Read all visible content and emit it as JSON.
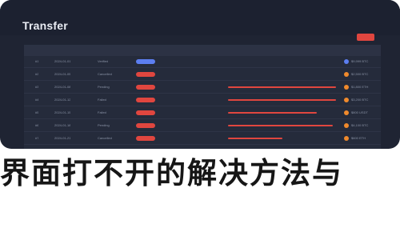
{
  "window": {
    "title": "Transfer"
  },
  "grid": {
    "rows": [
      {
        "id": "#1",
        "date": "2024-01-01",
        "name": "Verified",
        "status_color": "#5c7ef0",
        "line_fraction": 0.0,
        "dot_color": "#5c7ef0",
        "amount": "$9,999 BTC"
      },
      {
        "id": "#2",
        "date": "2024-01-05",
        "name": "Cancelled",
        "status_color": "#e0463f",
        "line_fraction": 0.0,
        "dot_color": "#f08a2c",
        "amount": "$2,500 BTC"
      },
      {
        "id": "#3",
        "date": "2024-01-08",
        "name": "Pending",
        "status_color": "#e0463f",
        "line_fraction": 1.0,
        "dot_color": "#f08a2c",
        "amount": "$1,800 ETH"
      },
      {
        "id": "#4",
        "date": "2024-01-12",
        "name": "Failed",
        "status_color": "#e0463f",
        "line_fraction": 1.0,
        "dot_color": "#f08a2c",
        "amount": "$3,200 BTC"
      },
      {
        "id": "#5",
        "date": "2024-01-15",
        "name": "Failed",
        "status_color": "#e0463f",
        "line_fraction": 0.82,
        "dot_color": "#f08a2c",
        "amount": "$800 USDT"
      },
      {
        "id": "#6",
        "date": "2024-01-18",
        "name": "Pending",
        "status_color": "#e0463f",
        "line_fraction": 0.97,
        "dot_color": "#f08a2c",
        "amount": "$4,100 BTC"
      },
      {
        "id": "#7",
        "date": "2024-01-21",
        "name": "Cancelled",
        "status_color": "#e0463f",
        "line_fraction": 0.5,
        "dot_color": "#f08a2c",
        "amount": "$600 ETH"
      }
    ]
  },
  "caption": "界面打不开的解决方法与"
}
